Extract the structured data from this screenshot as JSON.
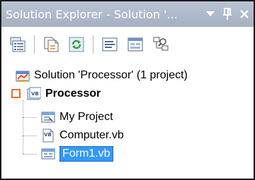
{
  "window": {
    "title": "Solution Explorer - Solution '...",
    "buttons": {
      "dropdown_icon": "chevron-down-icon",
      "pin_icon": "pin-icon",
      "close_icon": "close-icon"
    }
  },
  "toolbar": {
    "items": [
      {
        "name": "properties-icon"
      },
      {
        "name": "show-all-files-icon"
      },
      {
        "name": "refresh-icon"
      },
      {
        "name": "view-code-icon"
      },
      {
        "name": "view-designer-icon"
      },
      {
        "name": "class-diagram-icon"
      }
    ]
  },
  "tree": {
    "solution_label": "Solution 'Processor' (1 project)",
    "project_label": "Processor",
    "children": [
      {
        "label": "My Project"
      },
      {
        "label": "Computer.vb"
      },
      {
        "label": "Form1.vb"
      }
    ]
  },
  "colors": {
    "titlebar": "#a9b5c6",
    "selection": "#3399ff",
    "collapse_box": "#e0702f"
  }
}
